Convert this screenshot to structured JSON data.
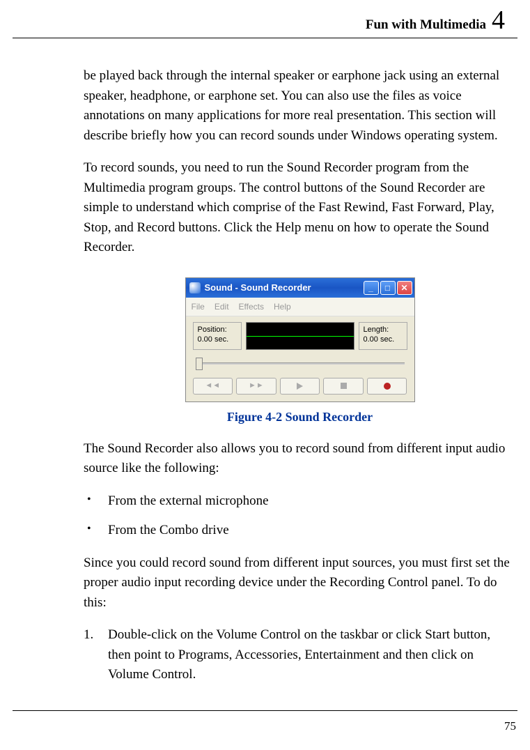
{
  "header": {
    "title": "Fun with Multimedia",
    "chapter": "4"
  },
  "paras": {
    "p1": "be played back through the internal speaker or earphone jack using an external speaker, headphone, or earphone set. You can also use the files as voice annotations on many applications for more real presentation. This section will describe briefly how you can record sounds under Windows operating system.",
    "p2": "To record sounds, you need to run the Sound Recorder program from the Multimedia program groups. The control buttons of the Sound Recorder are simple to understand which comprise of the Fast Rewind, Fast Forward, Play, Stop, and Record buttons. Click the Help menu on how to operate the Sound Recorder.",
    "p3": "The Sound Recorder also allows you to record sound from different input audio source like the following:",
    "p4": "Since you could record sound from different input sources, you must first set the proper audio input recording device under the Recording Control panel. To do this:"
  },
  "app": {
    "title": "Sound - Sound Recorder",
    "menus": [
      "File",
      "Edit",
      "Effects",
      "Help"
    ],
    "position_label": "Position:",
    "position_value": "0.00 sec.",
    "length_label": "Length:",
    "length_value": "0.00 sec."
  },
  "figure_caption": "Figure 4-2    Sound Recorder",
  "bullets": [
    "From the external microphone",
    "From the Combo drive"
  ],
  "steps": [
    "Double-click on the Volume Control on the taskbar or click Start button, then point to Programs, Accessories, Entertainment and then click on Volume Control."
  ],
  "page_number": "75"
}
